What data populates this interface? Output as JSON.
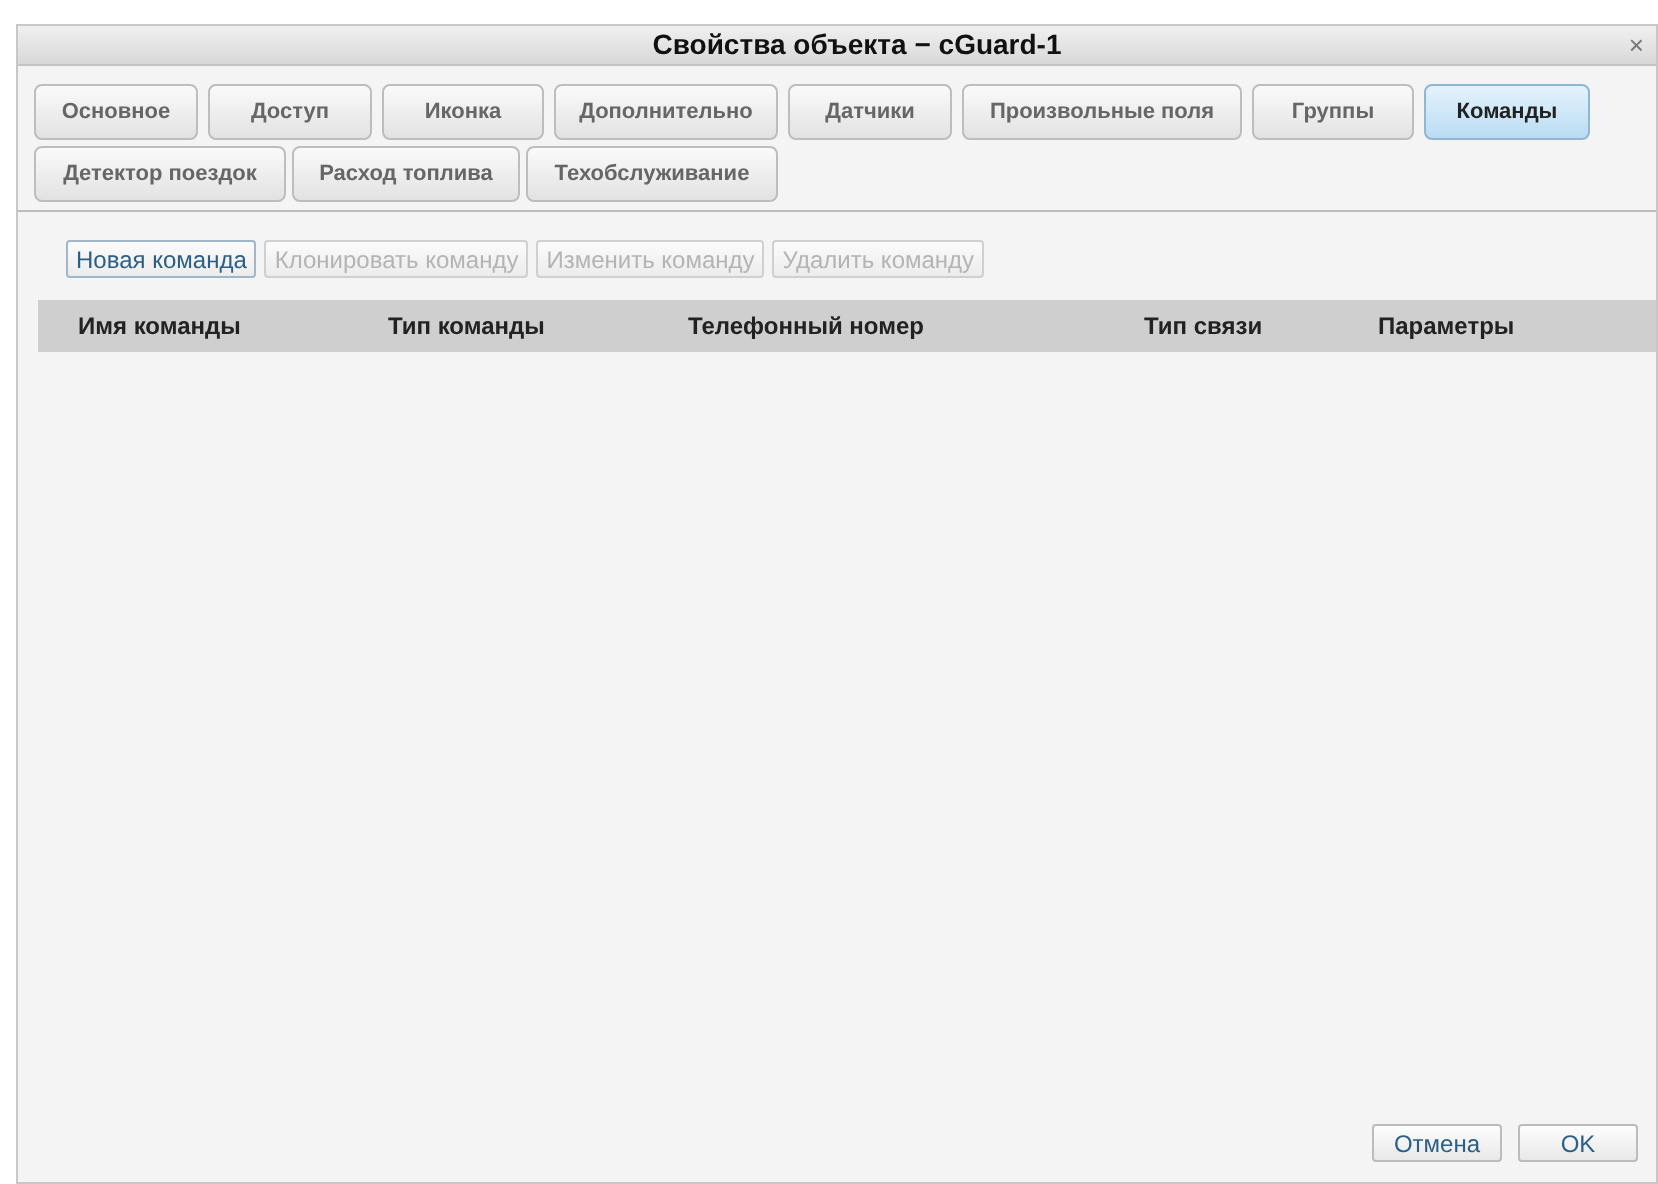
{
  "window": {
    "title": "Свойства объекта − cGuard-1",
    "close": "×"
  },
  "tabs": [
    {
      "label": "Основное",
      "selected": false
    },
    {
      "label": "Доступ",
      "selected": false
    },
    {
      "label": "Иконка",
      "selected": false
    },
    {
      "label": "Дополнительно",
      "selected": false
    },
    {
      "label": "Датчики",
      "selected": false
    },
    {
      "label": "Произвольные поля",
      "selected": false
    },
    {
      "label": "Группы",
      "selected": false
    },
    {
      "label": "Команды",
      "selected": true
    },
    {
      "label": "Детектор поездок",
      "selected": false
    },
    {
      "label": "Расход топлива",
      "selected": false
    },
    {
      "label": "Техобслуживание",
      "selected": false
    }
  ],
  "toolbar": [
    {
      "label": "Новая команда",
      "disabled": false
    },
    {
      "label": "Клонировать команду",
      "disabled": true
    },
    {
      "label": "Изменить команду",
      "disabled": true
    },
    {
      "label": "Удалить команду",
      "disabled": true
    }
  ],
  "table": {
    "columns": [
      "Имя команды",
      "Тип команды",
      "Телефонный номер",
      "Тип связи",
      "Параметры"
    ]
  },
  "buttons": [
    "Отмена",
    "OK"
  ]
}
